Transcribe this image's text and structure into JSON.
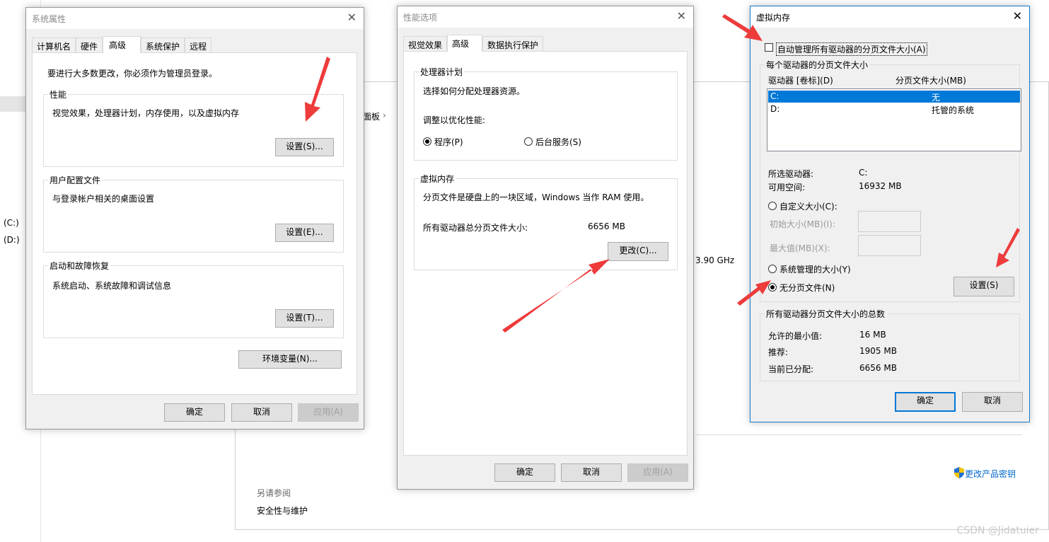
{
  "background": {
    "left_drive_c": "(C:)",
    "left_drive_d": "(D:)",
    "crumb_text": "面板",
    "crumb_sep": "›",
    "cpu_freq": "3.90 GHz",
    "see_also_title": "另请参阅",
    "see_also_link": "安全性与维护",
    "product_key_link": "更改产品密钥"
  },
  "sysprops": {
    "title": "系统属性",
    "tabs": [
      "计算机名",
      "硬件",
      "高级",
      "系统保护",
      "远程"
    ],
    "admin_note": "要进行大多数更改，你必须作为管理员登录。",
    "perf_legend": "性能",
    "perf_desc": "视觉效果，处理器计划，内存使用，以及虚拟内存",
    "perf_btn": "设置(S)...",
    "profile_legend": "用户配置文件",
    "profile_desc": "与登录帐户相关的桌面设置",
    "profile_btn": "设置(E)...",
    "startup_legend": "启动和故障恢复",
    "startup_desc": "系统启动、系统故障和调试信息",
    "startup_btn": "设置(T)...",
    "env_btn": "环境变量(N)...",
    "ok": "确定",
    "cancel": "取消",
    "apply": "应用(A)"
  },
  "perfopts": {
    "title": "性能选项",
    "tabs": [
      "视觉效果",
      "高级",
      "数据执行保护"
    ],
    "sched_legend": "处理器计划",
    "sched_desc": "选择如何分配处理器资源。",
    "optimize_label": "调整以优化性能:",
    "radio_programs": "程序(P)",
    "radio_services": "后台服务(S)",
    "vm_legend": "虚拟内存",
    "vm_desc": "分页文件是硬盘上的一块区域，Windows 当作 RAM 使用。",
    "vm_total_label": "所有驱动器总分页文件大小:",
    "vm_total_value": "6656 MB",
    "change_btn": "更改(C)...",
    "ok": "确定",
    "cancel": "取消",
    "apply": "应用(A)"
  },
  "vmem": {
    "title": "虚拟内存",
    "auto_manage": "自动管理所有驱动器的分页文件大小(A)",
    "auto_manage_checked": false,
    "per_drive_legend": "每个驱动器的分页文件大小",
    "col_drive": "驱动器 [卷标](D)",
    "col_size": "分页文件大小(MB)",
    "drives": [
      {
        "drive": "C:",
        "size": "无"
      },
      {
        "drive": "D:",
        "size": "托管的系统"
      }
    ],
    "selected_drive_label": "所选驱动器:",
    "selected_drive_value": "C:",
    "free_space_label": "可用空间:",
    "free_space_value": "16932 MB",
    "custom_size": "自定义大小(C):",
    "initial_size": "初始大小(MB)(I):",
    "max_size": "最大值(MB)(X):",
    "system_managed": "系统管理的大小(Y)",
    "no_paging": "无分页文件(N)",
    "set_btn": "设置(S)",
    "totals_legend": "所有驱动器分页文件大小的总数",
    "min_label": "允许的最小值:",
    "min_value": "16 MB",
    "recommended_label": "推荐:",
    "recommended_value": "1905 MB",
    "current_label": "当前已分配:",
    "current_value": "6656 MB",
    "ok": "确定",
    "cancel": "取消"
  },
  "watermark": "CSDN @Jidatuier",
  "colors": {
    "arrow": "#ee3b3b",
    "selection": "#0078d7",
    "dialog_bg": "#f0f0f0"
  }
}
